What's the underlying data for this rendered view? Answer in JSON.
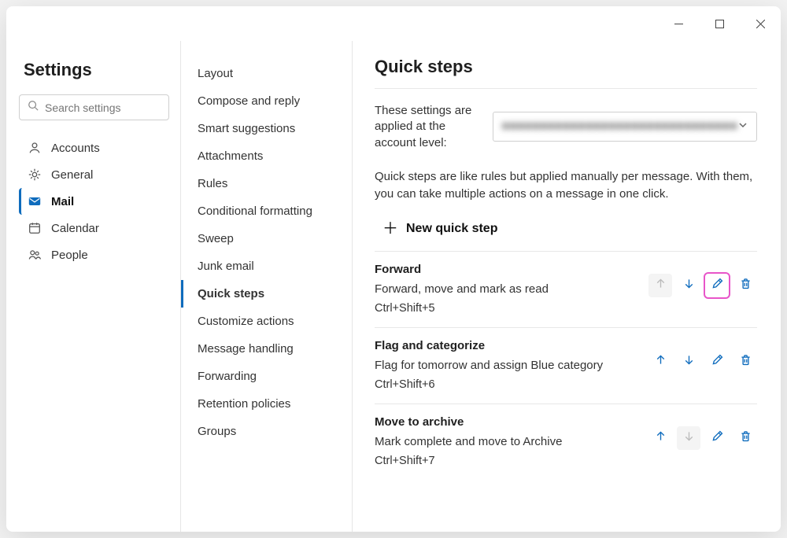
{
  "settings_title": "Settings",
  "search_placeholder": "Search settings",
  "sidenav": {
    "accounts": "Accounts",
    "general": "General",
    "mail": "Mail",
    "calendar": "Calendar",
    "people": "People"
  },
  "subnav": {
    "items": [
      "Layout",
      "Compose and reply",
      "Smart suggestions",
      "Attachments",
      "Rules",
      "Conditional formatting",
      "Sweep",
      "Junk email",
      "Quick steps",
      "Customize actions",
      "Message handling",
      "Forwarding",
      "Retention policies",
      "Groups"
    ]
  },
  "main": {
    "heading": "Quick steps",
    "account_label": "These settings are applied at the account level:",
    "account_value_blurred": "■■■■■■■■■■■■■■■■■■■■■■■■■■■■■■■",
    "description": "Quick steps are like rules but applied manually per message. With them, you can take multiple actions on a message in one click.",
    "new_step_label": "New quick step",
    "steps": [
      {
        "name": "Forward",
        "detail": "Forward, move and mark as read",
        "shortcut": "Ctrl+Shift+5",
        "up_disabled": true,
        "down_disabled": false,
        "edit_highlight": true
      },
      {
        "name": "Flag and categorize",
        "detail": "Flag for tomorrow and assign Blue category",
        "shortcut": "Ctrl+Shift+6",
        "up_disabled": false,
        "down_disabled": false,
        "edit_highlight": false
      },
      {
        "name": "Move to archive",
        "detail": "Mark complete and move to Archive",
        "shortcut": "Ctrl+Shift+7",
        "up_disabled": false,
        "down_disabled": true,
        "edit_highlight": false
      }
    ]
  }
}
